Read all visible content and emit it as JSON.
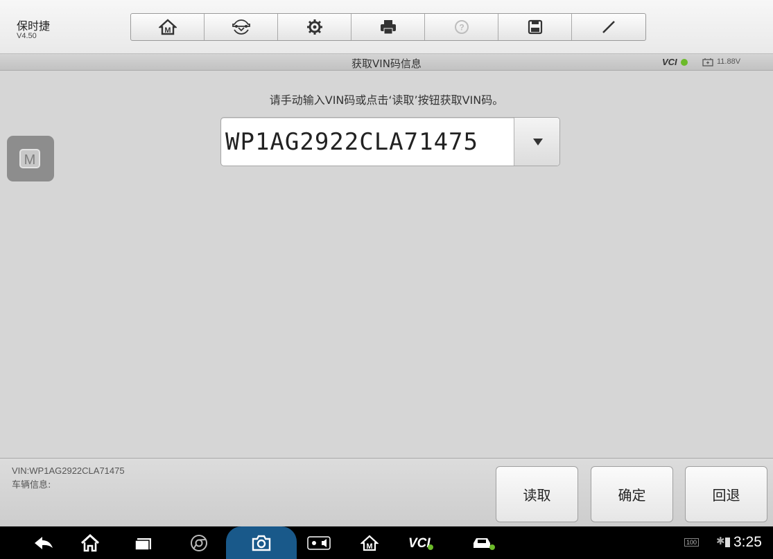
{
  "app": {
    "title": "保时捷",
    "version": "V4.50"
  },
  "toolbar": {
    "buttons": [
      {
        "name": "home",
        "icon": "home-m-icon"
      },
      {
        "name": "vehicle-swap",
        "icon": "car-swap-icon"
      },
      {
        "name": "settings",
        "icon": "gear-icon"
      },
      {
        "name": "print",
        "icon": "printer-icon"
      },
      {
        "name": "help",
        "icon": "help-icon"
      },
      {
        "name": "save",
        "icon": "floppy-icon"
      },
      {
        "name": "edit",
        "icon": "pen-icon"
      }
    ]
  },
  "titlebar": {
    "title": "获取VIN码信息",
    "vci": "VCI",
    "voltage": "11.88V"
  },
  "main": {
    "instruction": "请手动输入VIN码或点击‘读取’按钮获取VIN码。",
    "vin_value": "WP1AG2922CLA71475"
  },
  "bottom": {
    "vin_info": "VIN:WP1AG2922CLA71475",
    "vehicle_info": "车辆信息:",
    "buttons": {
      "read": "读取",
      "confirm": "确定",
      "back": "回退"
    }
  },
  "statusbar": {
    "time": "3:25",
    "level": "100"
  },
  "colors": {
    "vci_green": "#6cba2a",
    "camera_highlight": "#19598a"
  }
}
